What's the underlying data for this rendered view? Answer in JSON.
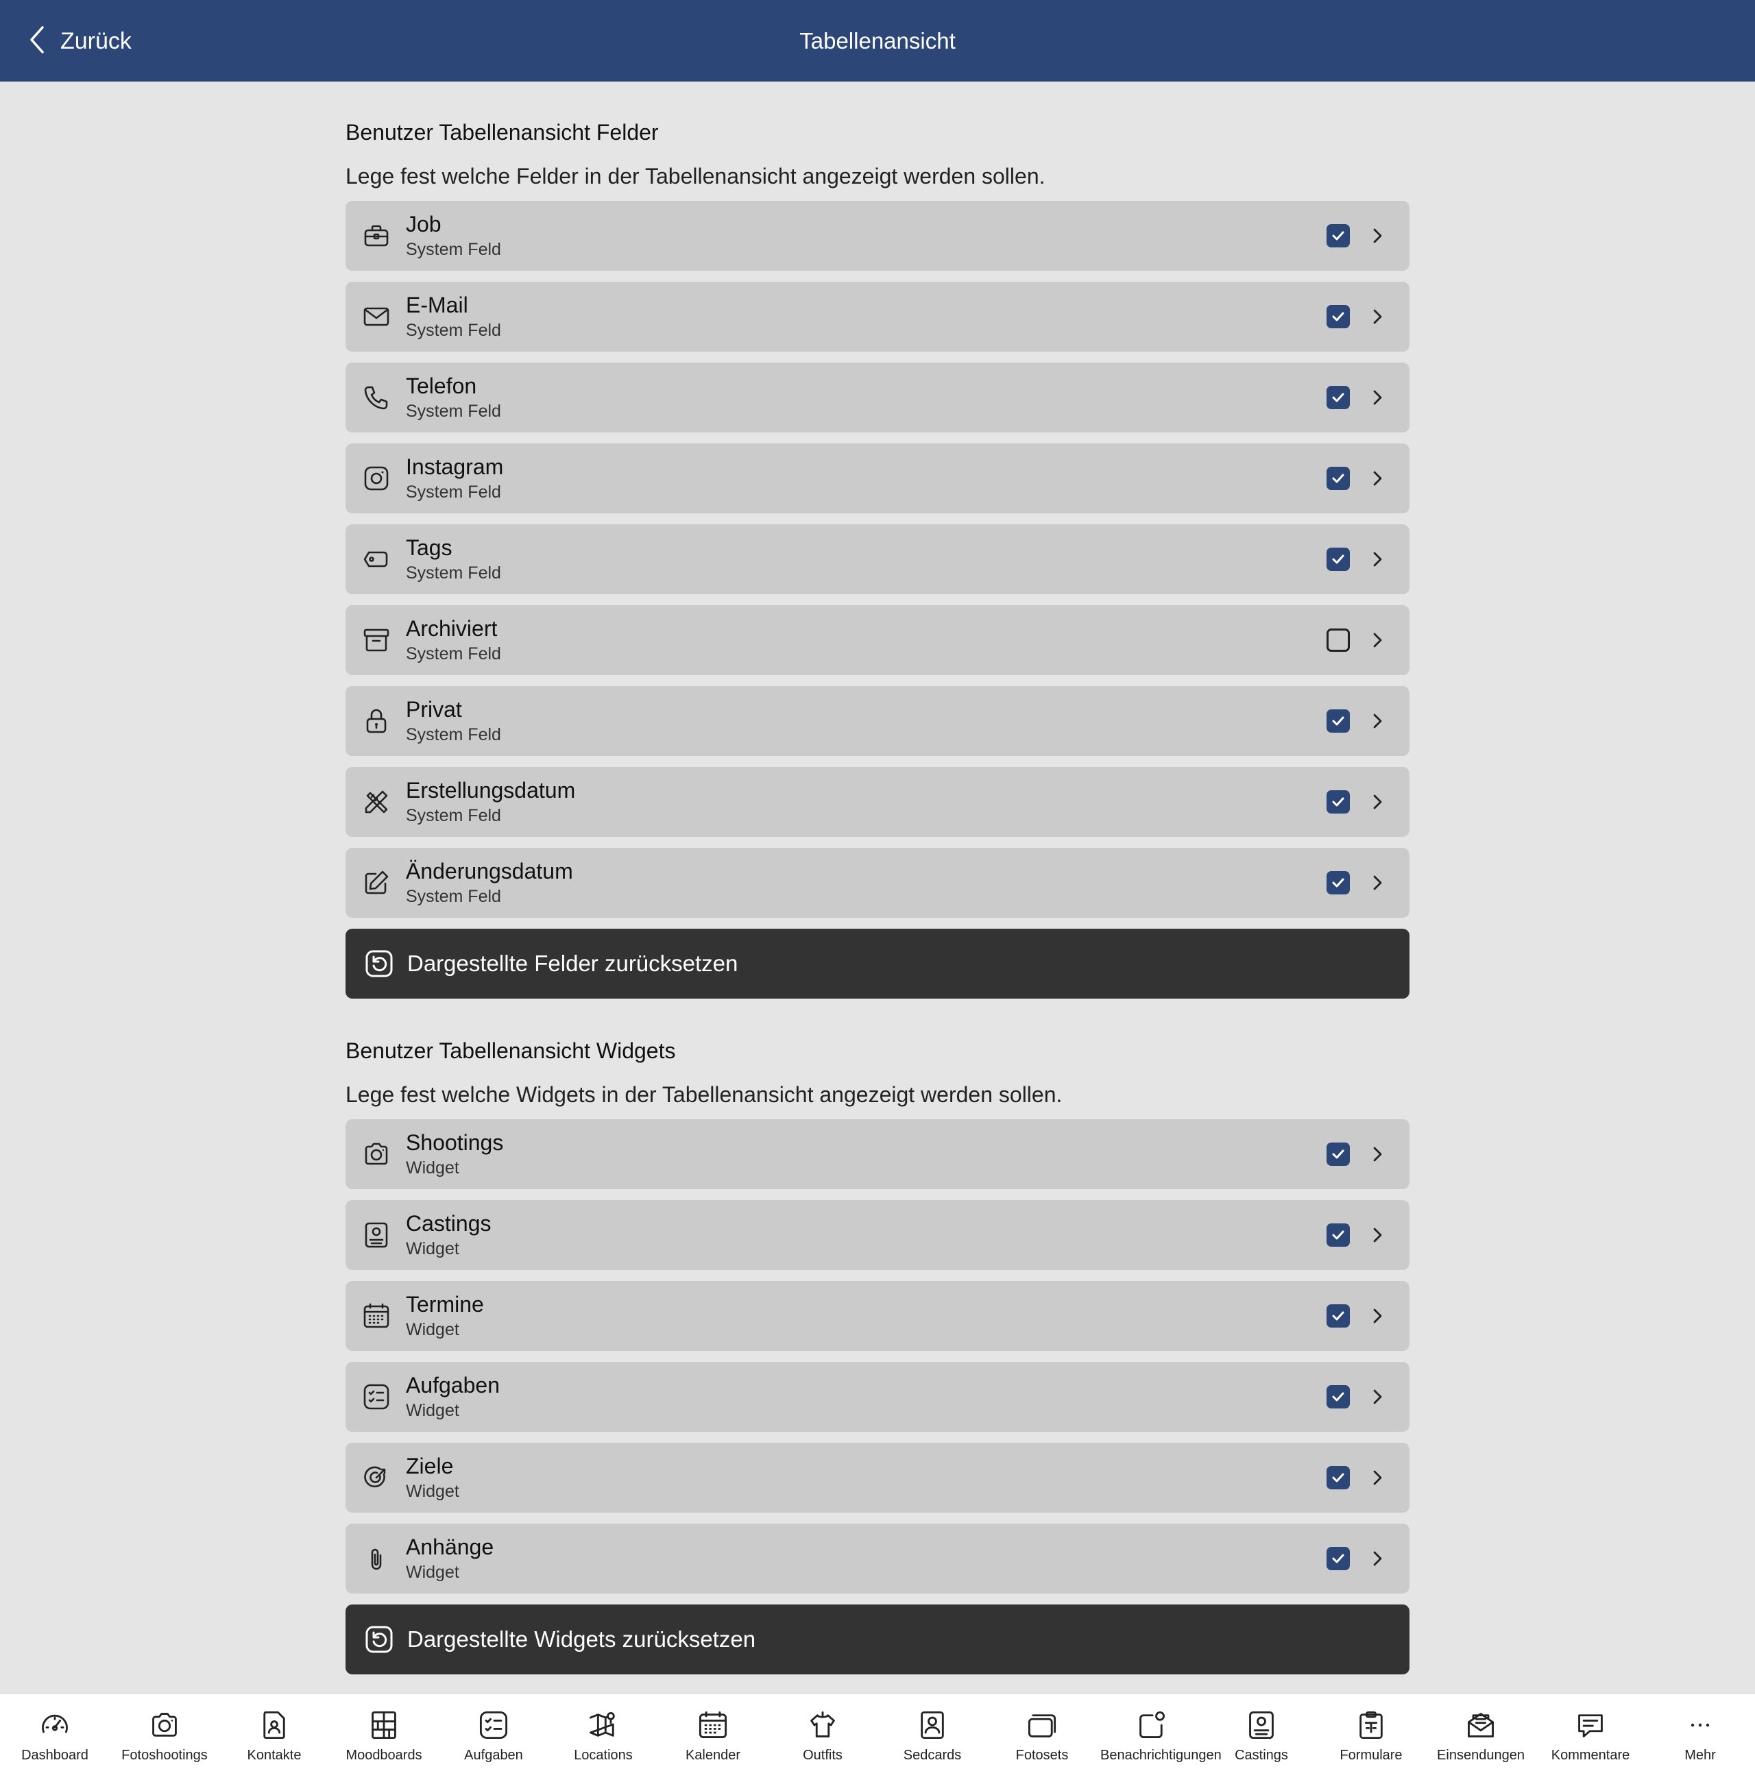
{
  "header": {
    "title": "Tabellenansicht",
    "back_label": "Zurück"
  },
  "fields_section": {
    "title": "Benutzer Tabellenansicht Felder",
    "description": "Lege fest welche Felder in der Tabellenansicht angezeigt werden sollen.",
    "items": [
      {
        "label": "Job",
        "sub": "System Feld",
        "icon": "briefcase-icon",
        "checked": true
      },
      {
        "label": "E-Mail",
        "sub": "System Feld",
        "icon": "mail-icon",
        "checked": true
      },
      {
        "label": "Telefon",
        "sub": "System Feld",
        "icon": "phone-icon",
        "checked": true
      },
      {
        "label": "Instagram",
        "sub": "System Feld",
        "icon": "instagram-icon",
        "checked": true
      },
      {
        "label": "Tags",
        "sub": "System Feld",
        "icon": "tag-icon",
        "checked": true
      },
      {
        "label": "Archiviert",
        "sub": "System Feld",
        "icon": "archive-icon",
        "checked": false
      },
      {
        "label": "Privat",
        "sub": "System Feld",
        "icon": "lock-icon",
        "checked": true
      },
      {
        "label": "Erstellungsdatum",
        "sub": "System Feld",
        "icon": "pencil-ruler-icon",
        "checked": true
      },
      {
        "label": "Änderungsdatum",
        "sub": "System Feld",
        "icon": "edit-icon",
        "checked": true
      }
    ],
    "reset_label": "Dargestellte Felder zurücksetzen"
  },
  "widgets_section": {
    "title": "Benutzer Tabellenansicht Widgets",
    "description": "Lege fest welche Widgets in der Tabellenansicht angezeigt werden sollen.",
    "items": [
      {
        "label": "Shootings",
        "sub": "Widget",
        "icon": "camera-icon",
        "checked": true
      },
      {
        "label": "Castings",
        "sub": "Widget",
        "icon": "id-card-icon",
        "checked": true
      },
      {
        "label": "Termine",
        "sub": "Widget",
        "icon": "calendar-icon",
        "checked": true
      },
      {
        "label": "Aufgaben",
        "sub": "Widget",
        "icon": "checklist-icon",
        "checked": true
      },
      {
        "label": "Ziele",
        "sub": "Widget",
        "icon": "target-icon",
        "checked": true
      },
      {
        "label": "Anhänge",
        "sub": "Widget",
        "icon": "paperclip-icon",
        "checked": true
      }
    ],
    "reset_label": "Dargestellte Widgets zurücksetzen"
  },
  "tabbar": [
    {
      "label": "Dashboard",
      "icon": "gauge-icon"
    },
    {
      "label": "Fotoshootings",
      "icon": "camera-icon"
    },
    {
      "label": "Kontakte",
      "icon": "contact-file-icon"
    },
    {
      "label": "Moodboards",
      "icon": "grid-board-icon"
    },
    {
      "label": "Aufgaben",
      "icon": "checklist-icon"
    },
    {
      "label": "Locations",
      "icon": "map-pin-icon"
    },
    {
      "label": "Kalender",
      "icon": "calendar-icon"
    },
    {
      "label": "Outfits",
      "icon": "shirt-icon"
    },
    {
      "label": "Sedcards",
      "icon": "portrait-icon"
    },
    {
      "label": "Fotosets",
      "icon": "photo-stack-icon"
    },
    {
      "label": "Benachrichtigungen",
      "icon": "notification-icon"
    },
    {
      "label": "Castings",
      "icon": "id-card-icon"
    },
    {
      "label": "Formulare",
      "icon": "clipboard-icon"
    },
    {
      "label": "Einsendungen",
      "icon": "mail-open-icon"
    },
    {
      "label": "Kommentare",
      "icon": "comment-icon"
    },
    {
      "label": "Mehr",
      "icon": "more-icon"
    }
  ],
  "colors": {
    "header_bg": "#2c4677",
    "accent": "#2c4677",
    "row_bg": "#cbcbcb",
    "button_bg": "#333333",
    "page_bg": "#e5e5e5"
  }
}
